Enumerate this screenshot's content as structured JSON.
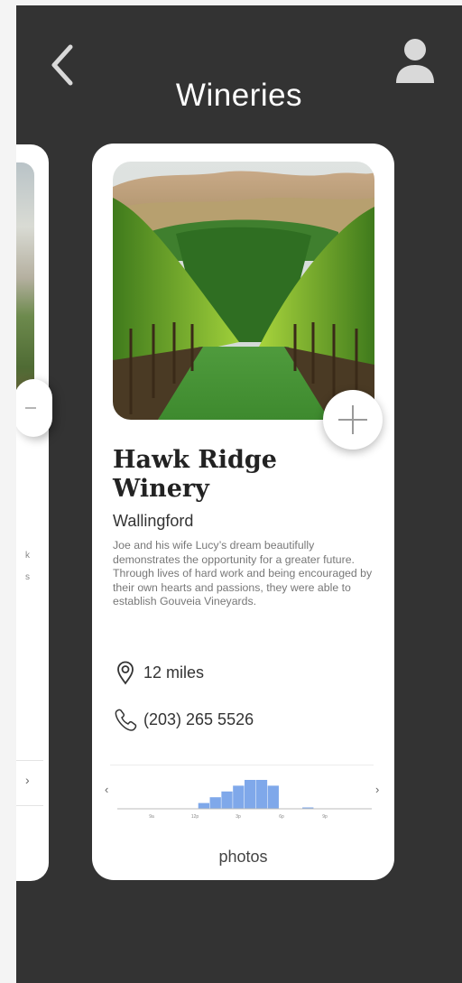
{
  "header": {
    "title": "Wineries",
    "back_icon": "chevron-left-icon",
    "profile_icon": "user-icon"
  },
  "peek_card": {
    "text_1": "k",
    "text_2": "s",
    "chevron": "›"
  },
  "card": {
    "name": "Hawk Ridge Winery",
    "location": "Wallingford",
    "description": "Joe and his wife Lucy’s dream beautifully demonstrates the opportunity for a greater future. Through lives of hard work and being encouraged by their own hearts and passions, they were able to establish Gouveia Vineyards.",
    "distance": "12 miles",
    "phone": "(203) 265 5526",
    "photos_label": "photos",
    "distance_icon": "map-pin-icon",
    "phone_icon": "phone-icon",
    "add_icon": "plus-icon"
  },
  "chart_data": {
    "type": "bar",
    "values": [
      0,
      0,
      0,
      0,
      0,
      0,
      0,
      1,
      2,
      3,
      4,
      5,
      5,
      4,
      0,
      0,
      0.1,
      0,
      0,
      0,
      0,
      0
    ],
    "tick_labels": [
      "9a",
      "12p",
      "3p",
      "6p",
      "9p"
    ],
    "bar_color": "#7fa8ea",
    "nav_prev": "‹",
    "nav_next": "›"
  },
  "colors": {
    "screen_bg": "#333333",
    "card_bg": "#ffffff",
    "bar": "#7fa8ea"
  }
}
